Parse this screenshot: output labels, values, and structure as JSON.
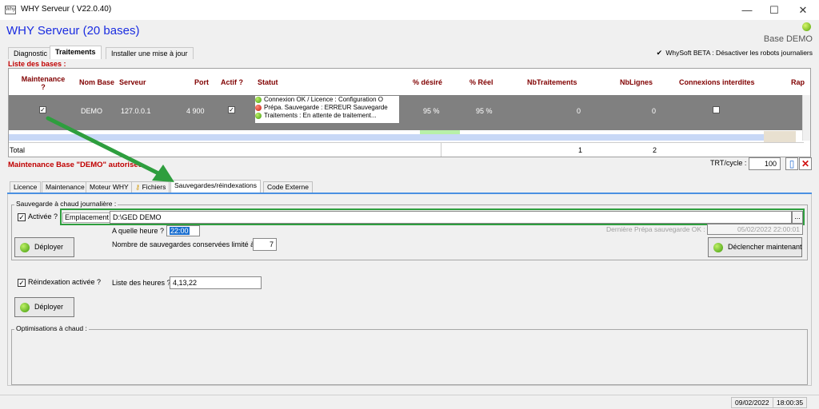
{
  "window": {
    "title": "WHY Serveur ( V22.0.40)",
    "icon_text": "Why",
    "minimize": "—",
    "maximize": "☐",
    "close": "✕"
  },
  "app": {
    "title": "WHY Serveur (20 bases)",
    "base_label": "Base DEMO"
  },
  "top_tabs": [
    "Diagnostic",
    "Traitements",
    "Installer une mise à jour"
  ],
  "beta_option": "WhySoft BETA : Désactiver les robots journaliers",
  "list_label": "Liste des bases :",
  "grid": {
    "headers": {
      "maintenance": "Maintenance",
      "maintenance2": "?",
      "nom_base": "Nom Base",
      "serveur": "Serveur",
      "port": "Port",
      "actif": "Actif ?",
      "statut": "Statut",
      "pct_desire": "% désiré",
      "pct_reel": "% Réel",
      "nb_traitements": "NbTraitements",
      "nb_lignes": "NbLignes",
      "connexions": "Connexions interdites",
      "rap": "Rap"
    },
    "row": {
      "nom": "DEMO",
      "serveur": "127.0.0.1",
      "port": "4 900",
      "status_lines": [
        "Connexion OK / Licence : Configuration O",
        "Prépa. Sauvegarde : ERREUR Sauvegarde",
        "Traitements : En attente de traitement..."
      ],
      "pct_desire": "95 %",
      "pct_reel": "95 %",
      "nb_traitements": "0",
      "nb_lignes": "0"
    },
    "total_label": "Total",
    "total_traitements": "1",
    "total_lignes": "2"
  },
  "maintenance_msg": "Maintenance Base \"DEMO\" autorisée",
  "trt_cycle": {
    "label": "TRT/cycle :",
    "value": "100"
  },
  "sub_tabs": [
    "Licence",
    "Maintenance",
    "Moteur WHY",
    "Fichiers",
    "Sauvegardes/réindexations",
    "Code Externe"
  ],
  "backup": {
    "group_title": "Sauvegarde à chaud journalière :",
    "activated_label": "Activée ?",
    "location_label": "Emplacement :",
    "location_value": "D:\\GED DEMO",
    "browse": "...",
    "hour_label": "A quelle heure ?",
    "hour_value": "22:00",
    "last_prep_label": "Dernière Prépa sauvegarde OK :",
    "last_prep_value": "05/02/2022 22:00:01",
    "count_label": "Nombre de sauvegardes conservées limité à :",
    "count_value": "7",
    "deploy_label": "Déployer",
    "trigger_label": "Déclencher maintenant"
  },
  "reindex": {
    "activated_label": "Réindexation activée ?",
    "hours_label": "Liste des heures ?",
    "hours_value": "4,13,22",
    "deploy_label": "Déployer"
  },
  "optim": {
    "title": "Optimisations à chaud :"
  },
  "status_bar": {
    "date": "09/02/2022",
    "time": "18:00:35"
  },
  "colors": {
    "accent": "#1a2ce0",
    "alert": "#c00000",
    "arrow": "#2e9e3e",
    "highlight_box": "#2e9e3e"
  }
}
